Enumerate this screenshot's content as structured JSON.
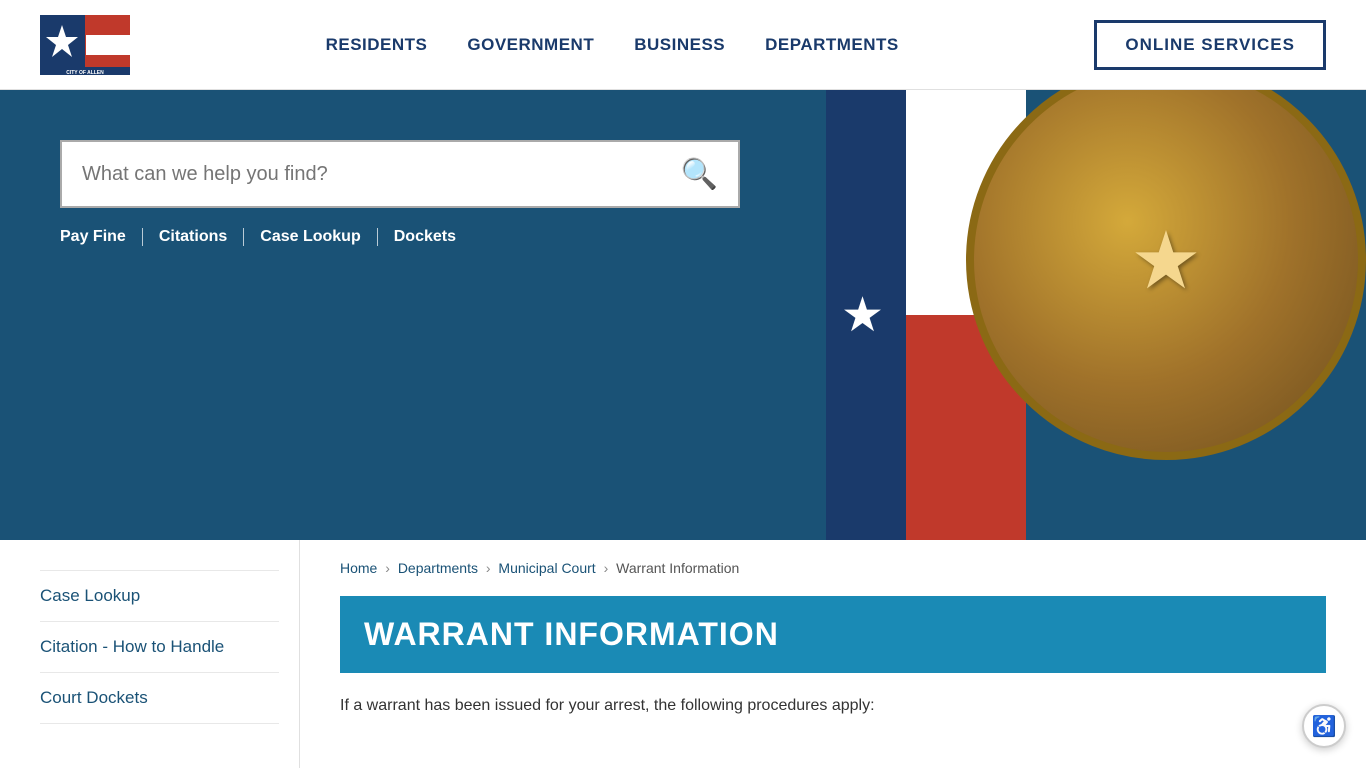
{
  "header": {
    "logo_alt": "City of Allen",
    "logo_text": "CITY OF ALLEN",
    "nav": [
      {
        "label": "RESIDENTS",
        "id": "residents"
      },
      {
        "label": "GOVERNMENT",
        "id": "government"
      },
      {
        "label": "BUSINESS",
        "id": "business"
      },
      {
        "label": "DEPARTMENTS",
        "id": "departments"
      }
    ],
    "online_services_label": "ONLINE SERVICES"
  },
  "hero": {
    "search_placeholder": "What can we help you find?",
    "quick_links": [
      {
        "label": "Pay Fine",
        "id": "pay-fine"
      },
      {
        "label": "Citations",
        "id": "citations"
      },
      {
        "label": "Case Lookup",
        "id": "case-lookup"
      },
      {
        "label": "Dockets",
        "id": "dockets"
      }
    ]
  },
  "sidebar": {
    "items": [
      {
        "label": "Case Lookup",
        "id": "case-lookup"
      },
      {
        "label": "Citation - How to Handle",
        "id": "citation-how-to-handle"
      },
      {
        "label": "Court Dockets",
        "id": "court-dockets"
      }
    ]
  },
  "breadcrumb": {
    "items": [
      {
        "label": "Home",
        "link": true
      },
      {
        "label": "Departments",
        "link": true
      },
      {
        "label": "Municipal Court",
        "link": true
      },
      {
        "label": "Warrant Information",
        "link": false
      }
    ]
  },
  "content": {
    "page_title": "WARRANT INFORMATION",
    "description": "If a warrant has been issued for your arrest, the following procedures apply:"
  },
  "accessibility": {
    "icon": "♿"
  }
}
